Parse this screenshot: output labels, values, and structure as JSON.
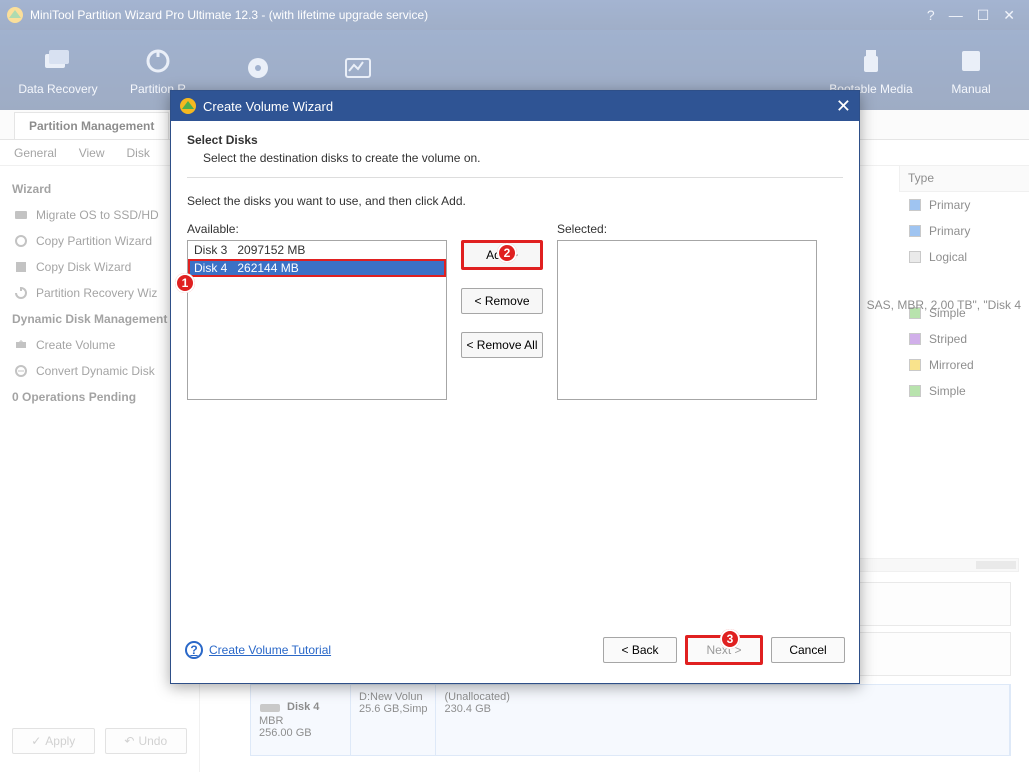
{
  "title": "MiniTool Partition Wizard Pro Ultimate 12.3 - (with lifetime upgrade service)",
  "toolbar": [
    {
      "label": "Data Recovery"
    },
    {
      "label": "Partition R"
    },
    {
      "label": ""
    },
    {
      "label": ""
    },
    {
      "label": "Bootable Media"
    },
    {
      "label": "Manual"
    }
  ],
  "tab": "Partition Management",
  "menus": [
    "General",
    "View",
    "Disk"
  ],
  "sidebar": {
    "wizard_hdr": "Wizard",
    "items": [
      "Migrate OS to SSD/HD",
      "Copy Partition Wizard",
      "Copy Disk Wizard",
      "Partition Recovery Wiz"
    ],
    "dyn_hdr": "Dynamic Disk Management",
    "dyn_items": [
      "Create Volume",
      "Convert Dynamic Disk"
    ],
    "ops": "0 Operations Pending",
    "apply": "Apply",
    "undo": "Undo"
  },
  "type_hdr": "Type",
  "types": [
    {
      "color": "#2a7de1",
      "label": "Primary"
    },
    {
      "color": "#2a7de1",
      "label": "Primary"
    },
    {
      "color": "#b7b7b7",
      "label": "Logical"
    },
    {
      "color": "#63c04a",
      "label": "Simple"
    },
    {
      "color": "#9a4fd1",
      "label": "Striped"
    },
    {
      "color": "#f2c200",
      "label": "Mirrored"
    },
    {
      "color": "#63c04a",
      "label": "Simple"
    }
  ],
  "disk_text": "SAS, MBR, 2.00 TB\", \"Disk 4",
  "diskrow": {
    "name": "Disk 4",
    "scheme": "MBR",
    "size": "256.00 GB",
    "p1": {
      "t": "D:New Volun",
      "s": "25.6 GB,Simp"
    },
    "p2": {
      "t": "(Unallocated)",
      "s": "230.4 GB"
    }
  },
  "dialog": {
    "title": "Create Volume Wizard",
    "hdr": "Select Disks",
    "sub": "Select the destination disks to create the volume on.",
    "instr": "Select the disks you want to use, and then click Add.",
    "avail_lbl": "Available:",
    "sel_lbl": "Selected:",
    "available": [
      "Disk 3   2097152 MB",
      "Disk 4   262144 MB"
    ],
    "btn_add": "Add >",
    "btn_remove": "< Remove",
    "btn_remove_all": "< Remove All",
    "help": "Create Volume Tutorial",
    "back": "< Back",
    "next": "Next >",
    "cancel": "Cancel"
  },
  "badges": {
    "b1": "1",
    "b2": "2",
    "b3": "3"
  }
}
